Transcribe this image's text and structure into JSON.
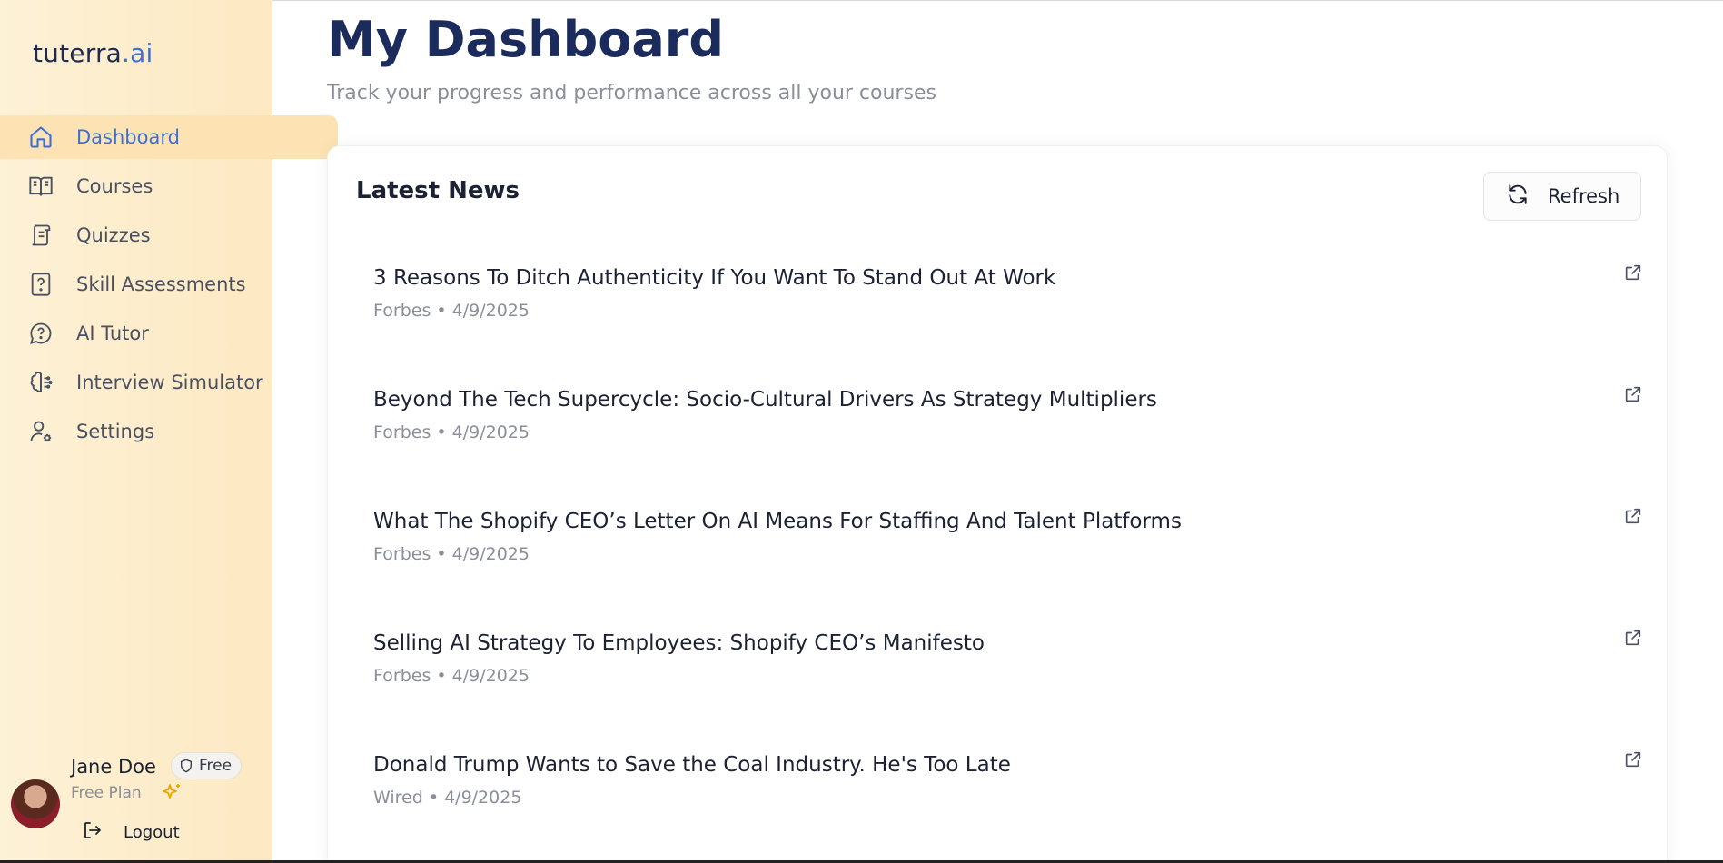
{
  "brand": {
    "name_part1": "tuterra",
    "name_part2": ".ai"
  },
  "sidebar": {
    "items": [
      {
        "label": "Dashboard",
        "icon": "home-icon",
        "active": true
      },
      {
        "label": "Courses",
        "icon": "book-open-icon"
      },
      {
        "label": "Quizzes",
        "icon": "scroll-icon"
      },
      {
        "label": "Skill Assessments",
        "icon": "question-file-icon"
      },
      {
        "label": "AI Tutor",
        "icon": "help-chat-icon"
      },
      {
        "label": "Interview Simulator",
        "icon": "brain-icon"
      },
      {
        "label": "Settings",
        "icon": "user-gear-icon"
      }
    ]
  },
  "user": {
    "name": "Jane Doe",
    "badge": "Free",
    "plan": "Free Plan",
    "logout_label": "Logout"
  },
  "main": {
    "title": "My Dashboard",
    "subtitle": "Track your progress and performance across all your courses"
  },
  "news": {
    "title": "Latest News",
    "refresh_label": "Refresh",
    "items": [
      {
        "title": "3 Reasons To Ditch Authenticity If You Want To Stand Out At Work",
        "meta": "Forbes • 4/9/2025"
      },
      {
        "title": "Beyond The Tech Supercycle: Socio-Cultural Drivers As Strategy Multipliers",
        "meta": "Forbes • 4/9/2025"
      },
      {
        "title": "What The Shopify CEO’s Letter On AI Means For Staffing And Talent Platforms",
        "meta": "Forbes • 4/9/2025"
      },
      {
        "title": "Selling AI Strategy To Employees: Shopify CEO’s Manifesto",
        "meta": "Forbes • 4/9/2025"
      },
      {
        "title": "Donald Trump Wants to Save the Coal Industry. He's Too Late",
        "meta": "Wired • 4/9/2025"
      }
    ]
  },
  "colors": {
    "accent": "#3f6fd6",
    "title": "#1a2b5c",
    "sidebar_bg": "#fdf1d6",
    "active_bg": "#fde3b4",
    "sparkle": "#f0a500"
  }
}
